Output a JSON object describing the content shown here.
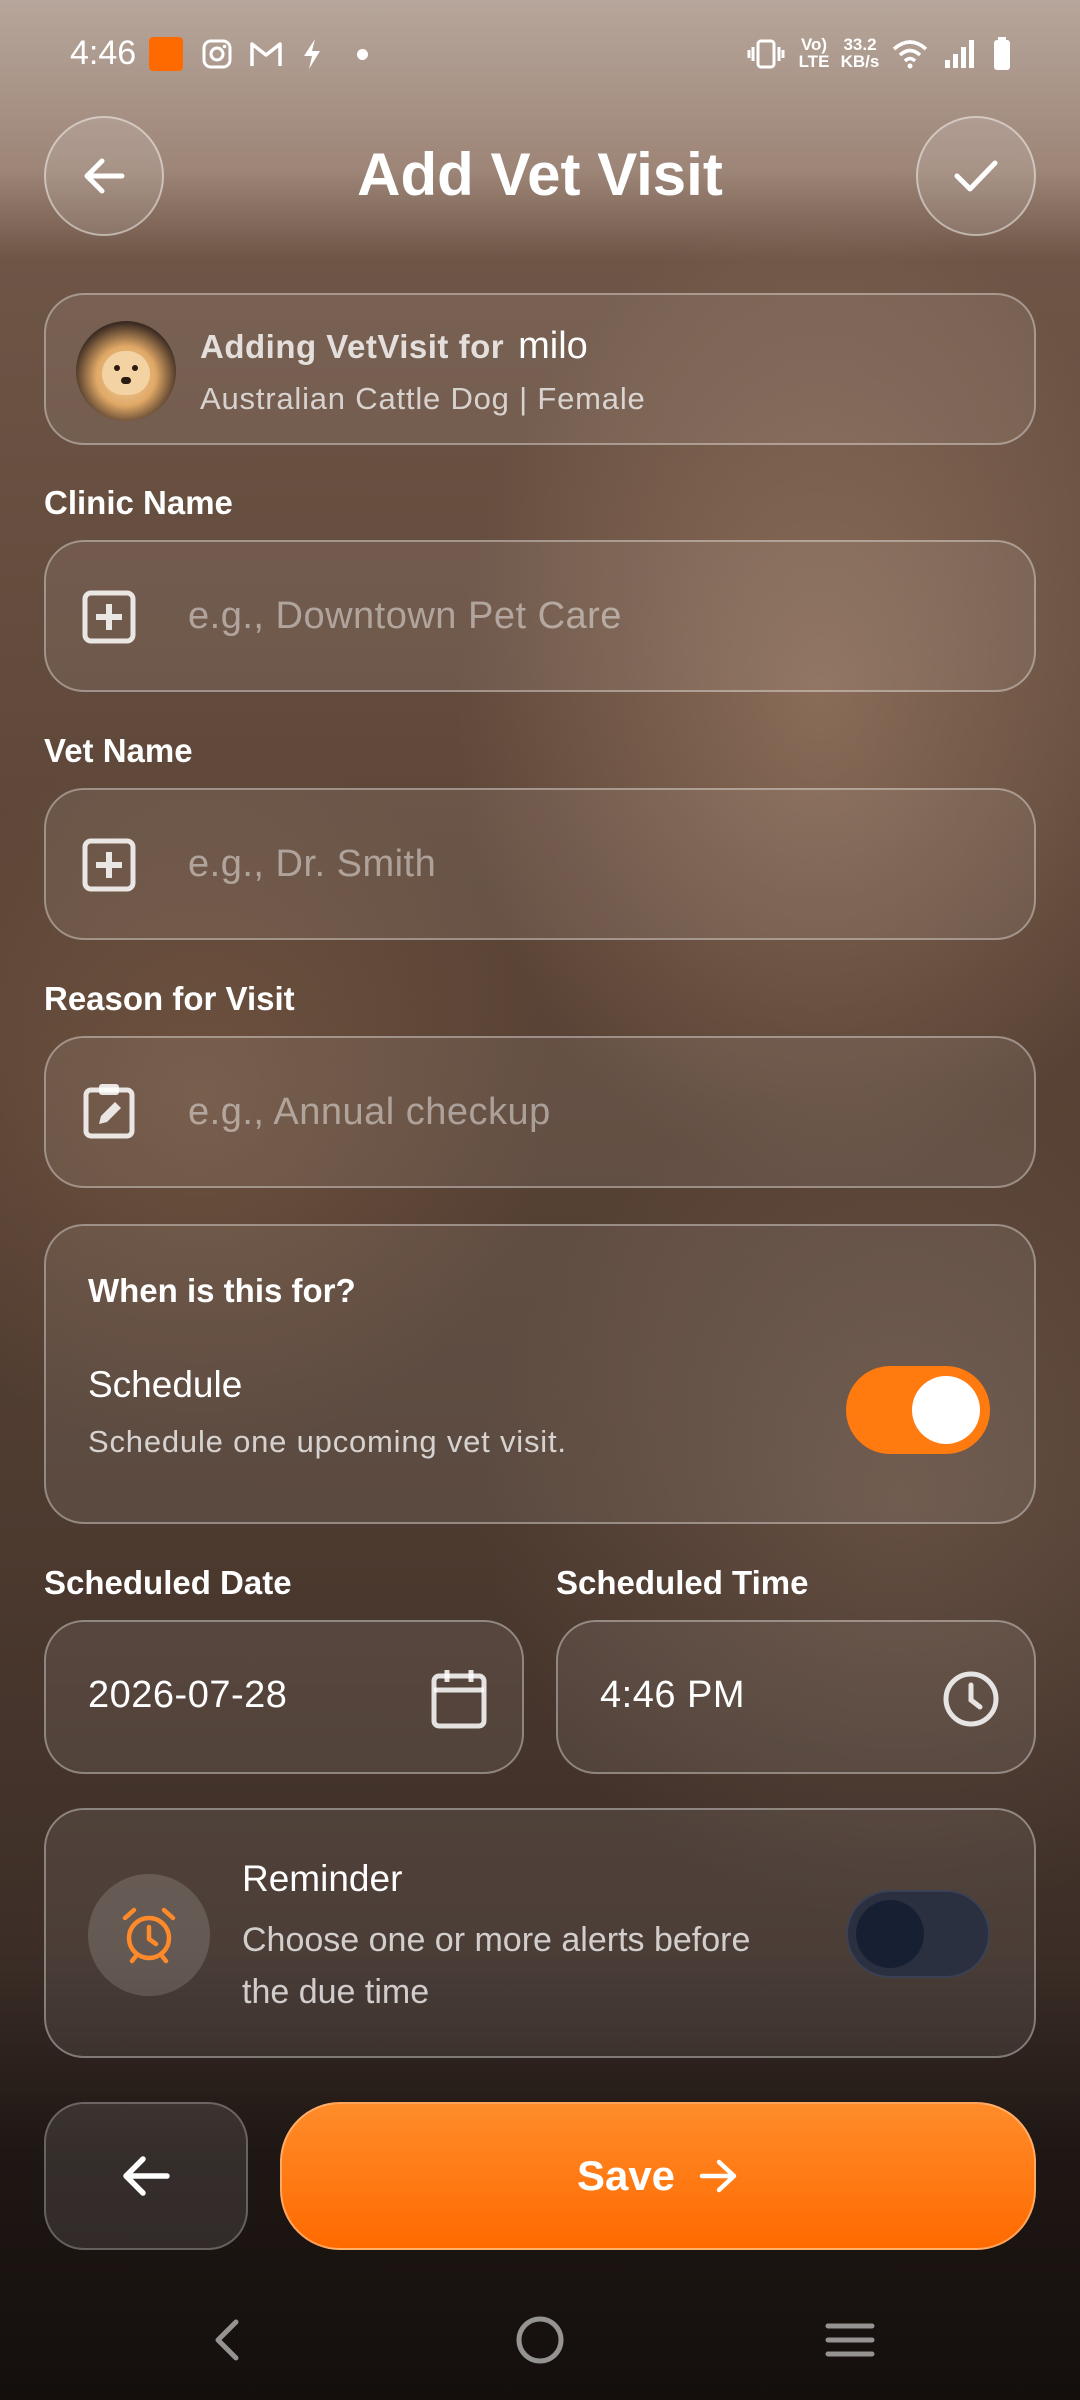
{
  "status_bar": {
    "time": "4:46",
    "speed_value": "33.2",
    "speed_unit": "KB/s",
    "volte": "Vo)",
    "lte": "LTE",
    "icons": [
      "app-notification-icon",
      "instagram-icon",
      "gmail-icon",
      "bolt-icon",
      "dot-icon",
      "vibrate-icon",
      "wifi-icon",
      "signal-icon",
      "battery-icon"
    ]
  },
  "header": {
    "title": "Add Vet Visit",
    "back_icon": "arrow-left-icon",
    "confirm_icon": "check-icon"
  },
  "pet_card": {
    "prefix": "Adding VetVisit for",
    "pet_name": "milo",
    "details": "Australian Cattle Dog | Female"
  },
  "fields": {
    "clinic": {
      "label": "Clinic Name",
      "placeholder": "e.g., Downtown Pet Care",
      "icon": "medical-plus-icon"
    },
    "vet": {
      "label": "Vet Name",
      "placeholder": "e.g., Dr. Smith",
      "icon": "medical-plus-icon"
    },
    "reason": {
      "label": "Reason for Visit",
      "placeholder": "e.g., Annual checkup",
      "icon": "clipboard-edit-icon"
    }
  },
  "when": {
    "heading": "When is this for?",
    "schedule_title": "Schedule",
    "schedule_desc": "Schedule one upcoming vet visit.",
    "schedule_on": true
  },
  "date_time": {
    "date_label": "Scheduled Date",
    "date_value": "2026-07-28",
    "time_label": "Scheduled Time",
    "time_value": "4:46 PM"
  },
  "reminder": {
    "title": "Reminder",
    "desc_line1": "Choose one or more alerts before",
    "desc_line2": "the due time",
    "enabled": false
  },
  "actions": {
    "save_label": "Save"
  },
  "colors": {
    "accent": "#ff7a0f",
    "toggle_off": "#2a3040"
  }
}
